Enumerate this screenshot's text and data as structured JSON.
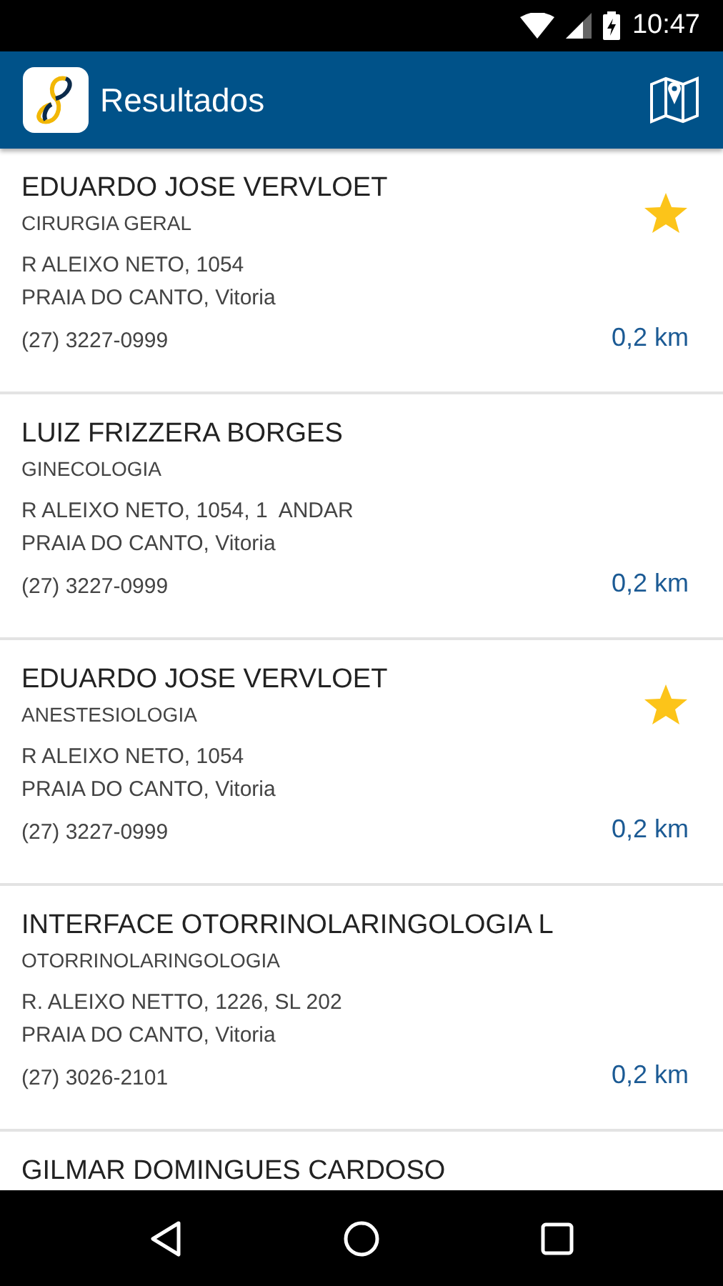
{
  "status_bar": {
    "time": "10:47"
  },
  "app_bar": {
    "title": "Resultados"
  },
  "results": [
    {
      "name": "EDUARDO JOSE VERVLOET",
      "specialty": "CIRURGIA GERAL",
      "address": "R ALEIXO NETO, 1054",
      "district": "PRAIA DO CANTO, Vitoria",
      "phone": "(27) 3227-0999",
      "distance": "0,2 km",
      "favorite": true
    },
    {
      "name": "LUIZ FRIZZERA BORGES",
      "specialty": "GINECOLOGIA",
      "address": "R ALEIXO NETO, 1054, 1  ANDAR",
      "district": "PRAIA DO CANTO, Vitoria",
      "phone": "(27) 3227-0999",
      "distance": "0,2 km",
      "favorite": false
    },
    {
      "name": "EDUARDO JOSE VERVLOET",
      "specialty": "ANESTESIOLOGIA",
      "address": "R ALEIXO NETO, 1054",
      "district": "PRAIA DO CANTO, Vitoria",
      "phone": "(27) 3227-0999",
      "distance": "0,2 km",
      "favorite": true
    },
    {
      "name": "INTERFACE OTORRINOLARINGOLOGIA L",
      "specialty": "OTORRINOLARINGOLOGIA",
      "address": "R. ALEIXO NETTO, 1226, SL 202",
      "district": "PRAIA DO CANTO, Vitoria",
      "phone": "(27) 3026-2101",
      "distance": "0,2 km",
      "favorite": false
    },
    {
      "name": "GILMAR DOMINGUES CARDOSO"
    }
  ]
}
